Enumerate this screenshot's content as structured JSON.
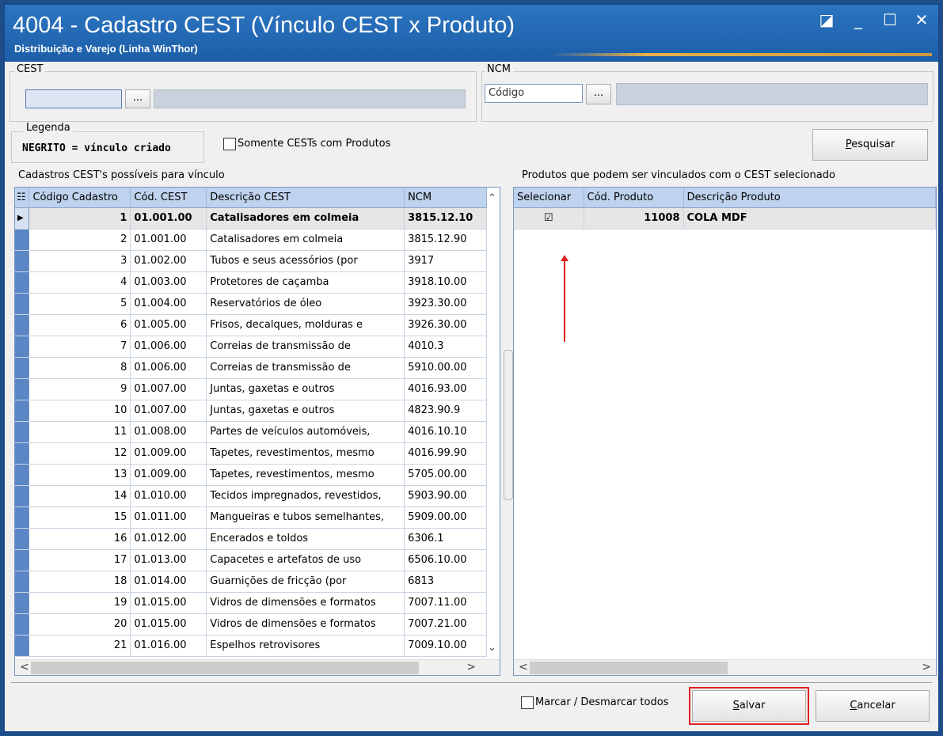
{
  "window": {
    "title": "4004 - Cadastro CEST (Vínculo CEST x Produto)",
    "subtitle": "Distribuição e Varejo (Linha WinThor)",
    "controls": [
      "◪",
      "_",
      "☐",
      "✕"
    ]
  },
  "cest": {
    "label": "CEST",
    "code_value": "",
    "lookup_label": "...",
    "description": ""
  },
  "ncm": {
    "label": "NCM",
    "code_placeholder": "Código",
    "lookup_label": "...",
    "description": ""
  },
  "legend": {
    "label": "Legenda",
    "text": "NEGRITO = vínculo criado"
  },
  "filter": {
    "only_with_products": "Somente CESTs com Produtos",
    "checked": false
  },
  "search_button": {
    "prefix": "",
    "underlined": "P",
    "rest": "esquisar"
  },
  "left_grid": {
    "title": "Cadastros CEST's possíveis para vínculo",
    "columns": [
      "Código Cadastro",
      "Cód. CEST",
      "Descrição CEST",
      "NCM"
    ],
    "rows": [
      [
        "1",
        "01.001.00",
        "Catalisadores em colmeia",
        "3815.12.10"
      ],
      [
        "2",
        "01.001.00",
        "Catalisadores em colmeia",
        "3815.12.90"
      ],
      [
        "3",
        "01.002.00",
        "Tubos e seus acessórios (por",
        "3917"
      ],
      [
        "4",
        "01.003.00",
        "Protetores de caçamba",
        "3918.10.00"
      ],
      [
        "5",
        "01.004.00",
        "Reservatórios de óleo",
        "3923.30.00"
      ],
      [
        "6",
        "01.005.00",
        "Frisos, decalques, molduras e",
        "3926.30.00"
      ],
      [
        "7",
        "01.006.00",
        "Correias de transmissão de",
        "4010.3"
      ],
      [
        "8",
        "01.006.00",
        "Correias de transmissão de",
        "5910.00.00"
      ],
      [
        "9",
        "01.007.00",
        "Juntas, gaxetas e outros",
        "4016.93.00"
      ],
      [
        "10",
        "01.007.00",
        "Juntas, gaxetas e outros",
        "4823.90.9"
      ],
      [
        "11",
        "01.008.00",
        "Partes de veículos automóveis,",
        "4016.10.10"
      ],
      [
        "12",
        "01.009.00",
        "Tapetes, revestimentos, mesmo",
        "4016.99.90"
      ],
      [
        "13",
        "01.009.00",
        "Tapetes, revestimentos, mesmo",
        "5705.00.00"
      ],
      [
        "14",
        "01.010.00",
        "Tecidos impregnados, revestidos,",
        "5903.90.00"
      ],
      [
        "15",
        "01.011.00",
        "Mangueiras e tubos semelhantes,",
        "5909.00.00"
      ],
      [
        "16",
        "01.012.00",
        "Encerados e toldos",
        "6306.1"
      ],
      [
        "17",
        "01.013.00",
        "Capacetes e artefatos de uso",
        "6506.10.00"
      ],
      [
        "18",
        "01.014.00",
        "Guarnições de fricção (por",
        "6813"
      ],
      [
        "19",
        "01.015.00",
        "Vidros de dimensões e formatos",
        "7007.11.00"
      ],
      [
        "20",
        "01.015.00",
        "Vidros de dimensões e formatos",
        "7007.21.00"
      ],
      [
        "21",
        "01.016.00",
        "Espelhos retrovisores",
        "7009.10.00"
      ]
    ]
  },
  "right_grid": {
    "title": "Produtos que podem ser vinculados com o CEST  selecionado",
    "columns": [
      "Selecionar",
      "Cód. Produto",
      "Descrição Produto"
    ],
    "rows": [
      {
        "checked": "☑",
        "code": "11008",
        "description": "COLA MDF"
      }
    ]
  },
  "footer": {
    "toggle_all": "Marcar / Desmarcar todos",
    "save": {
      "underlined": "S",
      "rest": "alvar"
    },
    "cancel": {
      "underlined": "C",
      "rest": "ancelar"
    }
  },
  "colors": {
    "title_bar": "#2c75c0",
    "grid_header": "#bfd3ee",
    "highlight": "#e02020"
  }
}
